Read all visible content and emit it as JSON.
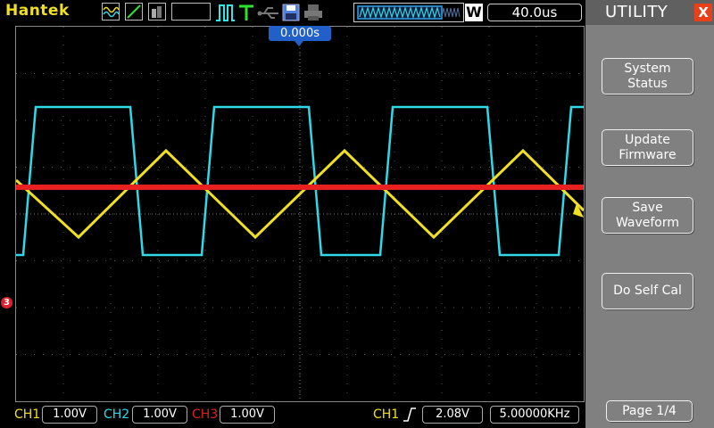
{
  "topbar": {
    "brand": "Hantek",
    "time_per_div": "40.0us",
    "wave_button": "W"
  },
  "screen": {
    "trigger_position": "0.000s",
    "ch3_marker": "3"
  },
  "status": {
    "ch1_label": "CH1",
    "ch1_scale": "1.00V",
    "ch2_label": "CH2",
    "ch2_scale": "1.00V",
    "ch3_label": "CH3",
    "ch3_scale": "1.00V",
    "trigger_source": "CH1",
    "trigger_level": "2.08V",
    "frequency": "5.00000KHz"
  },
  "menu": {
    "title": "UTILITY",
    "close": "X",
    "buttons": [
      {
        "line1": "System",
        "line2": "Status"
      },
      {
        "line1": "Update",
        "line2": "Firmware"
      },
      {
        "line1": "Save",
        "line2": "Waveform"
      },
      {
        "line1": "Do Self Cal",
        "line2": ""
      }
    ],
    "page": "Page 1/4"
  },
  "colors": {
    "ch1": "#f0e020",
    "ch2": "#30d8e8",
    "ch3": "#e82020",
    "menu_bg": "#808080",
    "trigger_marker": "#2060c8"
  }
}
